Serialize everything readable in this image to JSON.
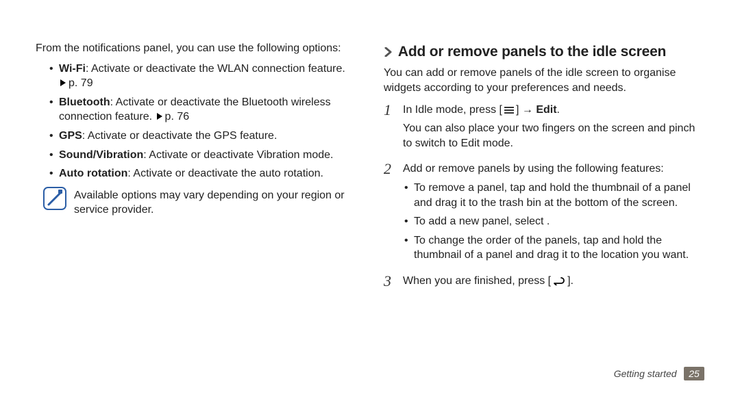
{
  "left": {
    "intro": "From the notifications panel, you can use the following options:",
    "bullets": [
      {
        "label": "Wi-Fi",
        "text": ": Activate or deactivate the WLAN connection feature. ",
        "page_ref": "p. 79"
      },
      {
        "label": "Bluetooth",
        "text": ": Activate or deactivate the Bluetooth wireless connection feature. ",
        "page_ref": "p. 76"
      },
      {
        "label": "GPS",
        "text": ": Activate or deactivate the GPS feature.",
        "page_ref": ""
      },
      {
        "label": "Sound/Vibration",
        "text": ": Activate or deactivate Vibration mode.",
        "page_ref": ""
      },
      {
        "label": "Auto rotation",
        "text": ": Activate or deactivate the auto rotation.",
        "page_ref": ""
      }
    ],
    "note_text": "Available options may vary depending on your region or service provider."
  },
  "right": {
    "heading": "Add or remove panels to the idle screen",
    "intro": "You can add or remove panels of the idle screen to organise widgets according to your preferences and needs.",
    "step1_a": "In Idle mode, press [",
    "step1_b": "] → ",
    "step1_edit": "Edit",
    "step1_c": ".",
    "step1_extra": "You can also place your two fingers on the screen and pinch to switch to Edit mode.",
    "step2_lead": "Add or remove panels by using the following features:",
    "step2_bullets": [
      "To remove a panel, tap and hold the thumbnail of a panel and drag it to the trash bin at the bottom of the screen.",
      "To add a new panel, select        .",
      "To change the order of the panels, tap and hold the thumbnail of a panel and drag it to the location you want."
    ],
    "step3_a": "When you are finished, press [",
    "step3_b": "]."
  },
  "footer": {
    "section": "Getting started",
    "page": "25"
  }
}
